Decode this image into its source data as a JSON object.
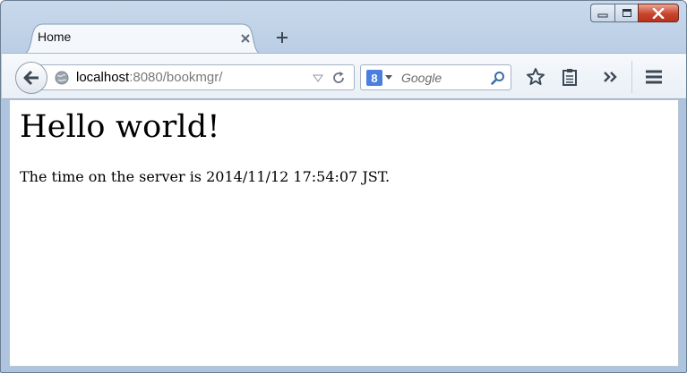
{
  "window": {
    "caption_buttons": [
      "minimize",
      "maximize",
      "close"
    ]
  },
  "tabs": [
    {
      "label": "Home",
      "active": true
    }
  ],
  "new_tab_label": "+",
  "navigation": {
    "url_host": "localhost",
    "url_rest": ":8080/bookmgr/",
    "search_engine_letter": "8",
    "search_placeholder": "Google"
  },
  "icons": {
    "back": "back-arrow-icon",
    "site_identity": "globe-icon",
    "url_dropdown": "dropdown-triangle-icon",
    "reload": "reload-icon",
    "search_engine": "google-icon",
    "search_go": "magnifier-icon",
    "bookmark": "star-icon",
    "reading_list": "clipboard-icon",
    "overflow": "double-chevron-icon",
    "menu": "hamburger-icon"
  },
  "page": {
    "heading": "Hello world!",
    "server_time_text": "The time on the server is 2014/11/12 17:54:07 JST."
  },
  "colors": {
    "frame": "#b9cde4",
    "close_button": "#c8452d",
    "url_host_text": "#000000",
    "url_rest_text": "#7a7a7a"
  }
}
